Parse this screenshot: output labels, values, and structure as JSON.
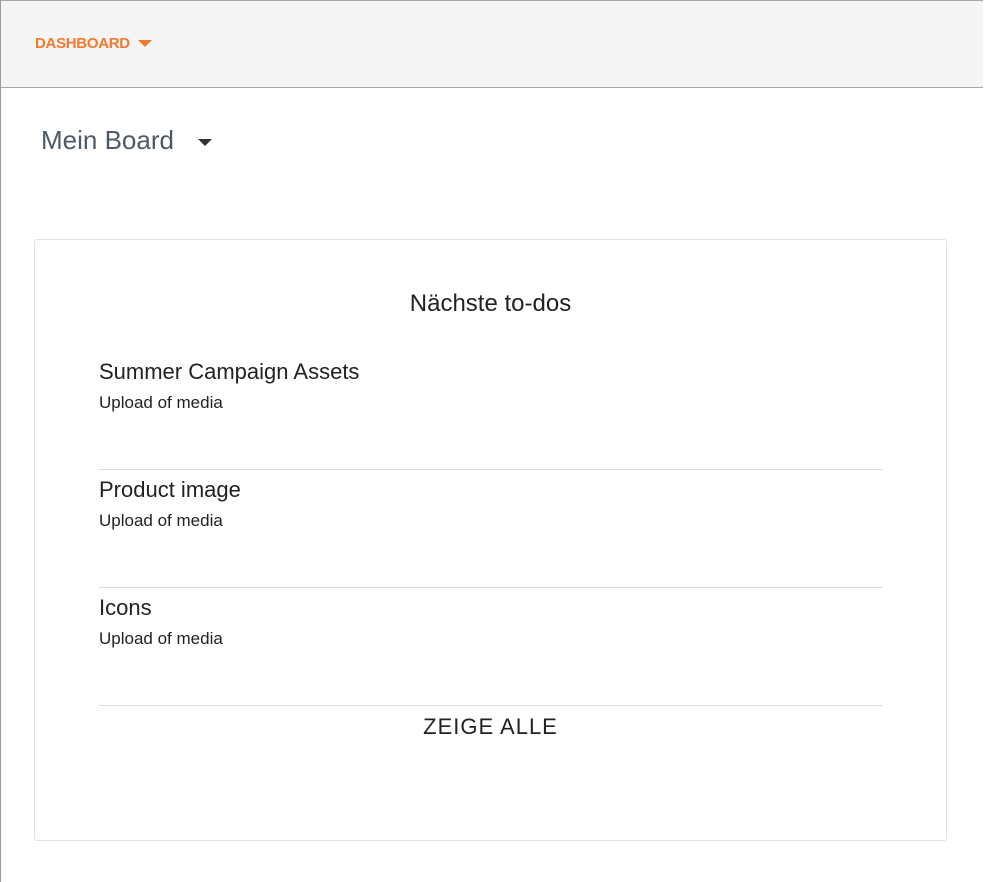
{
  "topbar": {
    "nav_label": "DASHBOARD"
  },
  "board_select": {
    "value": "Mein Board"
  },
  "card": {
    "title": "Nächste to-dos",
    "items": [
      {
        "title": "Summer Campaign Assets",
        "subtitle": "Upload of media"
      },
      {
        "title": "Product image",
        "subtitle": "Upload of media"
      },
      {
        "title": "Icons",
        "subtitle": "Upload of media"
      }
    ],
    "show_all_label": "ZEIGE ALLE"
  },
  "colors": {
    "accent": "#f07a2e",
    "text": "#222222",
    "muted_text": "#4e5a65",
    "topbar_bg": "#f5f5f5"
  }
}
